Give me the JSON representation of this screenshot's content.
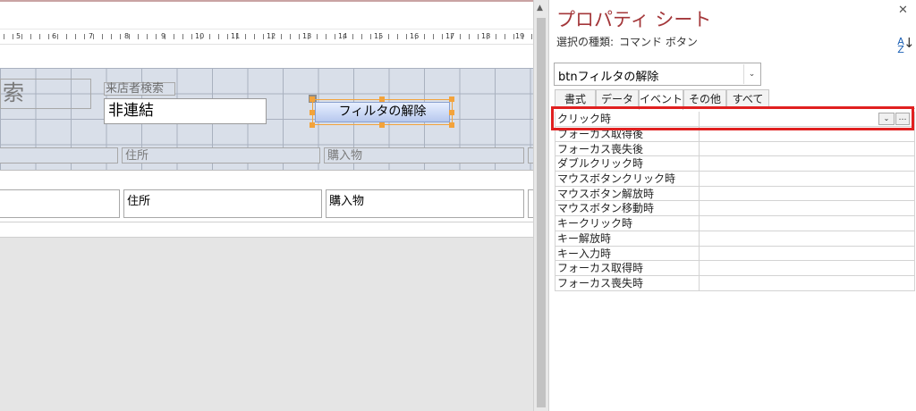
{
  "design": {
    "partial_label": "索",
    "search_label": "来店者検索",
    "search_textbox_value": "非連結",
    "filter_button_label": "フィルタの解除",
    "header_labels": [
      "住所",
      "購入物"
    ],
    "detail_labels": [
      "住所",
      "購入物"
    ],
    "ruler_numbers": [
      "5",
      "6",
      "7",
      "8",
      "9",
      "10",
      "11",
      "12",
      "13",
      "14",
      "15",
      "16",
      "17",
      "18",
      "19"
    ]
  },
  "property_sheet": {
    "title": "プロパティ シート",
    "selection_type_label": "選択の種類:",
    "selection_type_value": "コマンド ボタン",
    "sort_icon": "sort-az-icon",
    "object_name": "btnフィルタの解除",
    "tabs": [
      {
        "label": "書式"
      },
      {
        "label": "データ"
      },
      {
        "label": "イベント"
      },
      {
        "label": "その他"
      },
      {
        "label": "すべて"
      }
    ],
    "active_tab": "イベント",
    "rows": [
      "クリック時",
      "フォーカス取得後",
      "フォーカス喪失後",
      "ダブルクリック時",
      "マウスボタンクリック時",
      "マウスボタン解放時",
      "マウスボタン移動時",
      "キークリック時",
      "キー解放時",
      "キー入力時",
      "フォーカス取得時",
      "フォーカス喪失時"
    ],
    "highlight_color": "#e02020",
    "title_color": "#a4373a"
  }
}
